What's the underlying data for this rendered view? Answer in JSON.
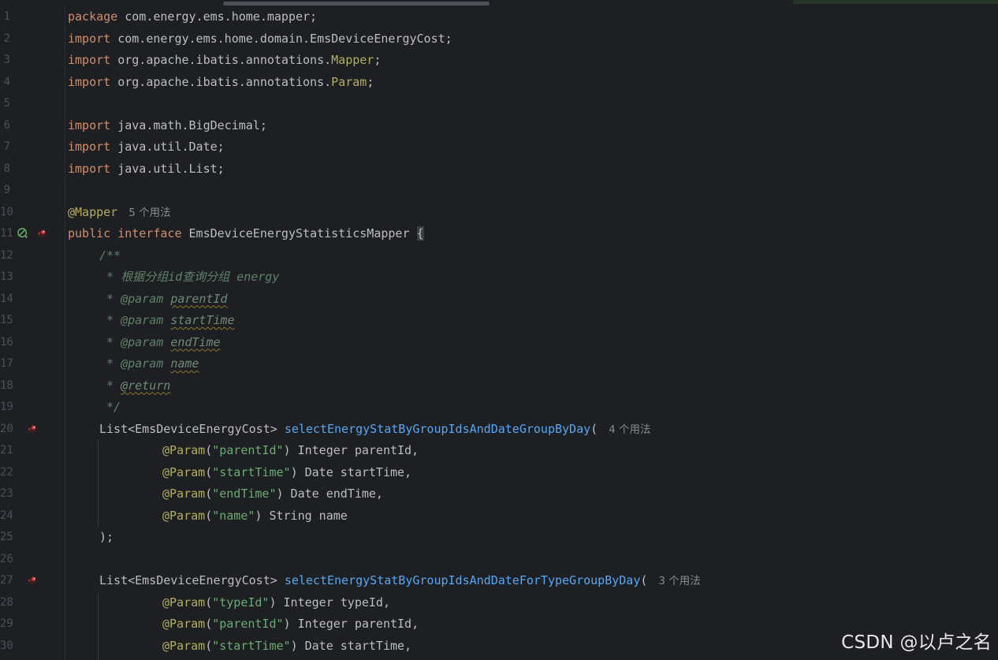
{
  "editor": {
    "colors": {
      "background": "#1e1f22",
      "keyword": "#cf8e6d",
      "annotation": "#b3ae60",
      "string": "#6aab73",
      "method": "#56a8f5",
      "comment": "#5f826b",
      "text": "#bcbec4",
      "inlay_hint": "#868a91",
      "line_number": "#4b5059"
    },
    "line_numbers": [
      "1",
      "2",
      "3",
      "4",
      "5",
      "6",
      "7",
      "8",
      "9",
      "10",
      "11",
      "12",
      "13",
      "14",
      "15",
      "16",
      "17",
      "18",
      "19",
      "20",
      "21",
      "22",
      "23",
      "24",
      "25",
      "26",
      "27",
      "28",
      "29",
      "30"
    ],
    "gutter_icons": {
      "line_11": [
        "no-bean-icon",
        "mybatis-bird-icon"
      ],
      "line_20": [
        "mybatis-bird-icon"
      ],
      "line_27": [
        "mybatis-bird-icon"
      ]
    },
    "code": {
      "l1": {
        "kw": "package",
        "rest": " com.energy.ems.home.mapper;"
      },
      "l2": {
        "kw": "import",
        "rest": " com.energy.ems.home.domain.EmsDeviceEnergyCost;"
      },
      "l3": {
        "kw": "import",
        "rest": " org.apache.ibatis.annotations.",
        "ann": "Mapper",
        "end": ";"
      },
      "l4": {
        "kw": "import",
        "rest": " org.apache.ibatis.annotations.",
        "ann": "Param",
        "end": ";"
      },
      "l6": {
        "kw": "import",
        "rest": " java.math.BigDecimal;"
      },
      "l7": {
        "kw": "import",
        "rest": " java.util.Date;"
      },
      "l8": {
        "kw": "import",
        "rest": " java.util.List;"
      },
      "l10": {
        "ann": "@Mapper",
        "hint": "5 个用法"
      },
      "l11": {
        "kw1": "public",
        "kw2": "interface",
        "name": " EmsDeviceEnergyStatisticsMapper ",
        "brace": "{"
      },
      "l12": {
        "comment": "/**"
      },
      "l13": {
        "comment": " * 根据分组id查询分组 energy"
      },
      "l14": {
        "prefix": " * ",
        "tag": "@param",
        "param": "parentId"
      },
      "l15": {
        "prefix": " * ",
        "tag": "@param",
        "param": "startTime"
      },
      "l16": {
        "prefix": " * ",
        "tag": "@param",
        "param": "endTime"
      },
      "l17": {
        "prefix": " * ",
        "tag": "@param",
        "param": "name"
      },
      "l18": {
        "prefix": " * ",
        "tag": "@return"
      },
      "l19": {
        "comment": " */"
      },
      "l20": {
        "type": "List<EmsDeviceEnergyCost> ",
        "method": "selectEnergyStatByGroupIdsAndDateGroupByDay",
        "open": "(",
        "hint": "4 个用法"
      },
      "l21": {
        "ann": "@Param",
        "open": "(",
        "str": "\"parentId\"",
        "rest": ") Integer parentId,"
      },
      "l22": {
        "ann": "@Param",
        "open": "(",
        "str": "\"startTime\"",
        "rest": ") Date startTime,"
      },
      "l23": {
        "ann": "@Param",
        "open": "(",
        "str": "\"endTime\"",
        "rest": ") Date endTime,"
      },
      "l24": {
        "ann": "@Param",
        "open": "(",
        "str": "\"name\"",
        "rest": ") String name"
      },
      "l25": {
        "text": ");"
      },
      "l27": {
        "type": "List<EmsDeviceEnergyCost> ",
        "method": "selectEnergyStatByGroupIdsAndDateForTypeGroupByDay",
        "open": "(",
        "hint": "3 个用法"
      },
      "l28": {
        "ann": "@Param",
        "open": "(",
        "str": "\"typeId\"",
        "rest": ") Integer typeId,"
      },
      "l29": {
        "ann": "@Param",
        "open": "(",
        "str": "\"parentId\"",
        "rest": ") Integer parentId,"
      },
      "l30": {
        "ann": "@Param",
        "open": "(",
        "str": "\"startTime\"",
        "rest": ") Date startTime,"
      }
    }
  },
  "watermark": "CSDN @以卢之名"
}
